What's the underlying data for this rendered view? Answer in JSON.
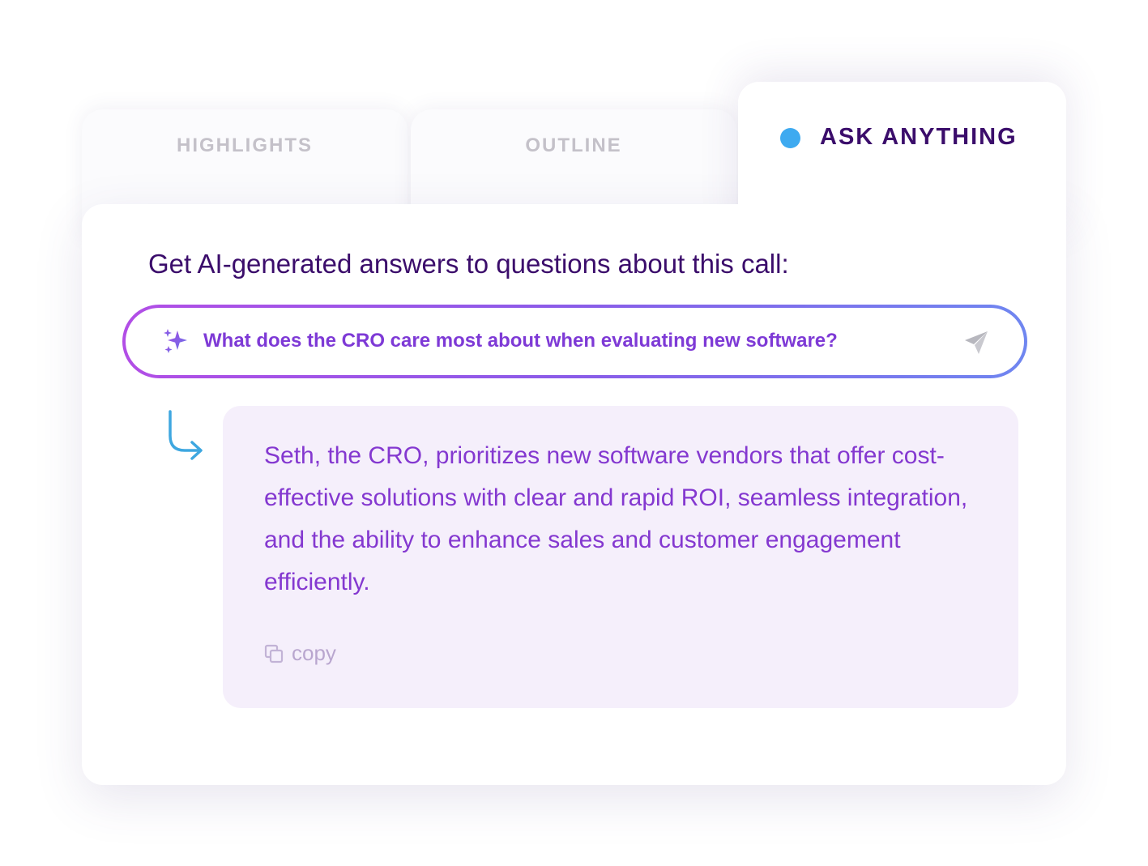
{
  "tabs": {
    "highlights": "HIGHLIGHTS",
    "outline": "OUTLINE",
    "ask_anything": "ASK ANYTHING"
  },
  "main": {
    "prompt_title": "Get AI-generated answers to questions about this call:",
    "search": {
      "value": "What does the CRO care most about when evaluating new software?"
    },
    "answer": {
      "text": "Seth, the CRO, prioritizes new software vendors that offer cost-effective solutions with clear and rapid ROI, seamless integration, and the ability to enhance sales and customer engagement efficiently.",
      "copy_label": "copy"
    }
  },
  "icons": {
    "active_tab_indicator": "dot-icon",
    "search_leading": "sparkle-icon",
    "search_trailing": "send-icon",
    "reply": "reply-arrow-icon",
    "copy": "copy-icon"
  },
  "colors": {
    "active_dot": "#3eaaf0",
    "active_tab_text": "#3b0d6b",
    "inactive_tab_text": "#c4c1c9",
    "title_text": "#3b0d6b",
    "search_text": "#7e3ad6",
    "answer_text": "#8438d0",
    "answer_bg": "#f5effb",
    "gradient_start": "#b24ee6",
    "gradient_end": "#6f86f0",
    "reply_arrow": "#3ea7e0"
  }
}
